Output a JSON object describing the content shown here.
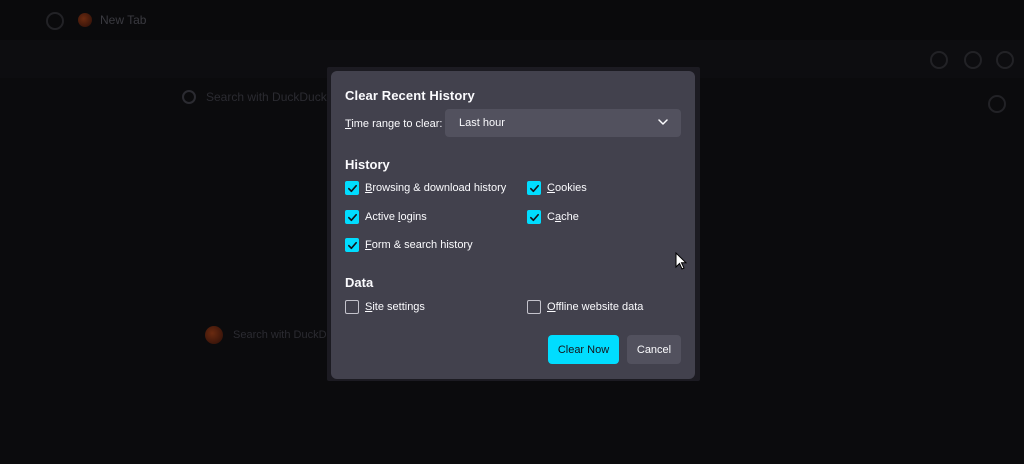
{
  "browser": {
    "tab_title": "New Tab",
    "search_placeholder": "Search with DuckDuckGo or enter address",
    "bottom_search_placeholder": "Search with DuckDuckGo"
  },
  "dialog": {
    "title": "Clear Recent History",
    "time_range": {
      "label_accesskey": "T",
      "label_rest": "ime range to clear:",
      "value": "Last hour"
    },
    "history_heading": "History",
    "history_items": [
      {
        "accesskey": "B",
        "rest": "rowsing & download history",
        "checked": true
      },
      {
        "accesskey": "C",
        "rest": "ookies",
        "checked": true
      },
      {
        "pre": "Active ",
        "accesskey": "l",
        "rest": "ogins",
        "checked": true
      },
      {
        "pre": "C",
        "accesskey": "a",
        "rest": "che",
        "checked": true
      },
      {
        "accesskey": "F",
        "rest": "orm & search history",
        "checked": true
      }
    ],
    "data_heading": "Data",
    "data_items": [
      {
        "accesskey": "S",
        "rest": "ite settings",
        "checked": false
      },
      {
        "accesskey": "O",
        "rest": "ffline website data",
        "checked": false
      }
    ],
    "clear_button": "Clear Now",
    "cancel_button": "Cancel"
  },
  "colors": {
    "accent": "#00ddff",
    "dialog_bg": "#42414d",
    "control_bg": "#52515e",
    "text": "#fbfbfe"
  }
}
